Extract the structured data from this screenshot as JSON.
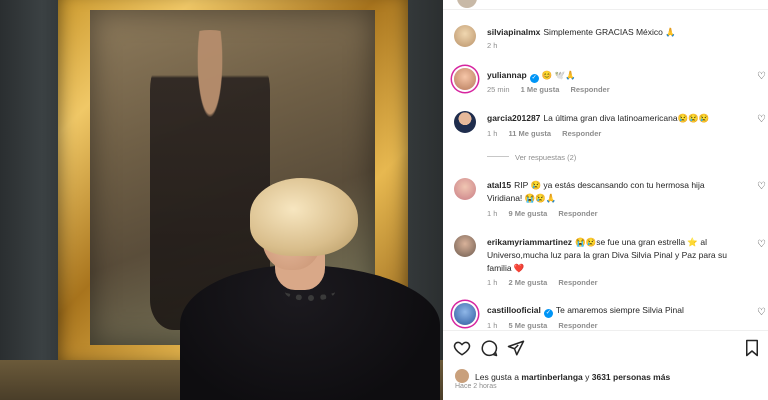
{
  "post": {
    "caption": {
      "user": "silviapinalmx",
      "text": "Simplemente GRACIAS México 🙏",
      "time": "2 h"
    }
  },
  "comments": [
    {
      "user": "yuliannap",
      "verified": true,
      "text": "😊 🕊️🙏",
      "time": "25 min",
      "likes": "1 Me gusta",
      "reply": "Responder"
    },
    {
      "user": "garcia201287",
      "verified": false,
      "text": "La última gran diva latinoamericana😢😢😢",
      "time": "1 h",
      "likes": "11 Me gusta",
      "reply": "Responder"
    },
    {
      "user": "atal15",
      "verified": false,
      "text": "RIP 😢 ya estás descansando con tu hermosa hija Viridiana! 😭😢🙏",
      "time": "1 h",
      "likes": "9 Me gusta",
      "reply": "Responder"
    },
    {
      "user": "erikamyriammartinez",
      "verified": false,
      "text": "😭😢se fue una gran estrella ⭐ al Universo,mucha luz para la gran Diva Silvia Pinal y Paz para su familia ❤️",
      "time": "1 h",
      "likes": "2 Me gusta",
      "reply": "Responder"
    },
    {
      "user": "castillooficial",
      "verified": true,
      "text": "Te amaremos siempre Silvia Pinal",
      "time": "1 h",
      "likes": "5 Me gusta",
      "reply": "Responder"
    }
  ],
  "view_replies": "Ver respuestas (2)",
  "likes_summary": {
    "prefix": "Les gusta a",
    "user": "martinberlanga",
    "middle": "y",
    "count": "3631 personas más"
  },
  "post_time": "Hace 2 horas",
  "icons": {
    "like": "heart-outline-icon",
    "comment": "comment-bubble-icon",
    "share": "paper-plane-icon",
    "save": "bookmark-icon",
    "comment_like": "heart-icon",
    "verified": "verified-badge-icon"
  },
  "colors": {
    "verified": "#0095f6",
    "story_ring": "#d6249f",
    "meta": "#8e8e8e",
    "text": "#262626"
  }
}
